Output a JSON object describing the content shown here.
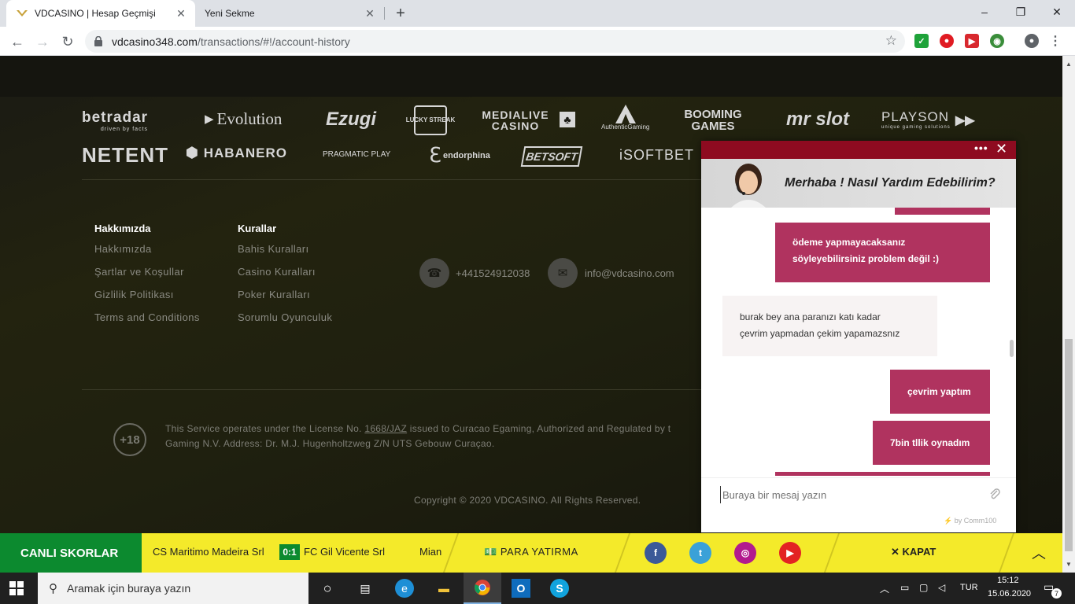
{
  "browser": {
    "tabs": [
      {
        "title": "VDCASINO | Hesap Geçmişi"
      },
      {
        "title": "Yeni Sekme"
      }
    ],
    "new_tab": "+",
    "window_controls": {
      "minimize": "–",
      "maximize": "❐",
      "close": "✕"
    },
    "nav": {
      "back": "←",
      "forward": "→",
      "reload": "↻"
    },
    "url": {
      "host": "vdcasino348.com",
      "path": "/transactions/#!/account-history"
    },
    "bookmark_star": "☆"
  },
  "providers": {
    "row1": [
      {
        "name": "betradar",
        "sub": "driven by facts"
      },
      {
        "name": "Evolution"
      },
      {
        "name": "Ezugi"
      },
      {
        "name": "LUCKY STREAK"
      },
      {
        "name": "MEDIALIVE CASINO"
      },
      {
        "name": "AuthenticGaming"
      },
      {
        "name": "BOOMING GAMES"
      },
      {
        "name": "mr slot"
      },
      {
        "name": "PLAYSON",
        "sub": "unique gaming solutions"
      }
    ],
    "row2": [
      {
        "name": "NETENT"
      },
      {
        "name": "HABANERO"
      },
      {
        "name": "PRAGMATIC PLAY"
      },
      {
        "name": "endorphina"
      },
      {
        "name": "BETSOFT"
      },
      {
        "name": "iSOFTBET"
      }
    ]
  },
  "footer": {
    "col1": {
      "heading": "Hakkımızda",
      "links": [
        "Hakkımızda",
        "Şartlar ve Koşullar",
        "Gizlilik Politikası",
        "Terms and Conditions"
      ]
    },
    "col2": {
      "heading": "Kurallar",
      "links": [
        "Bahis Kuralları",
        "Casino Kuralları",
        "Poker Kuralları",
        "Sorumlu Oyunculuk"
      ]
    },
    "phone": "+441524912038",
    "email": "info@vdcasino.com",
    "age": "+18",
    "license_pre": "This Service operates under the License No.",
    "license_no": "1668/JAZ",
    "license_post": "issued to Curacao Egaming, Authorized and Regulated by t",
    "license_line2": "Gaming N.V. Address: Dr. M.J. Hugenholtzweg Z/N UTS Gebouw Curaçao.",
    "copyright": "Copyright © 2020 VDCASINO. All Rights Reserved."
  },
  "chat": {
    "menu": "•••",
    "close": "✕",
    "banner": "Merhaba ! Nasıl Yardım Edebilirim?",
    "messages": [
      {
        "from": "user",
        "lines": [
          "ödeme yapmayacaksanız",
          "söyleyebilirsiniz problem değil :)"
        ]
      },
      {
        "from": "agent",
        "lines": [
          "burak bey ana paranızı katı kadar",
          "çevrim yapmadan çekim yapamazsnız"
        ]
      },
      {
        "from": "user",
        "lines": [
          "çevrim yaptım"
        ]
      },
      {
        "from": "user",
        "lines": [
          "7bin tllik oynadım"
        ]
      }
    ],
    "input_placeholder": "Buraya bir mesaj yazın",
    "powered_by": "by Comm100"
  },
  "sitebar": {
    "live_scores": "CANLI SKORLAR",
    "home_team": "CS Maritimo Madeira Srl",
    "score": "0:1",
    "away_team": "FC Gil Vicente Srl",
    "next_match": "Mian",
    "deposit": "PARA YATIRMA",
    "close": "KAPAT",
    "socials": [
      "facebook",
      "twitter",
      "instagram",
      "youtube"
    ]
  },
  "taskbar": {
    "search_placeholder": "Aramak için buraya yazın",
    "language": "TUR",
    "time": "15:12",
    "date": "15.06.2020",
    "notifications": "7"
  },
  "colors": {
    "chat_header": "#8e0b20",
    "chat_bubble_user": "#b0335f",
    "live_green": "#0c8a2f",
    "sitebar_yellow": "#f4ea2a"
  }
}
